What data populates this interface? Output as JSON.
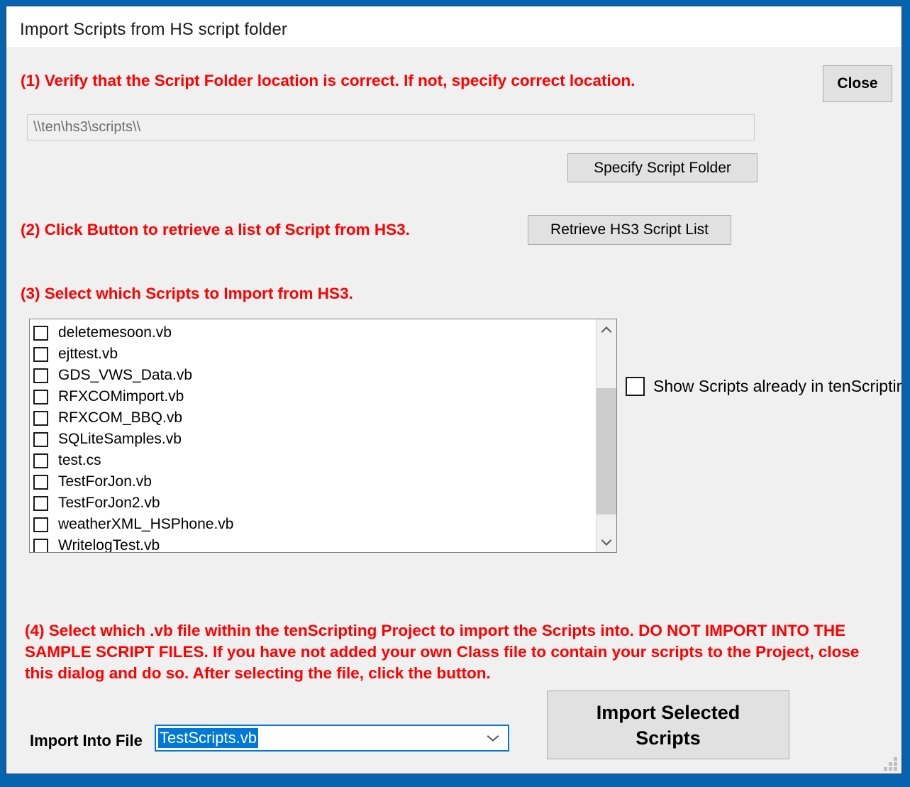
{
  "window": {
    "title": "Import Scripts from HS script folder",
    "border_color": "#0563af",
    "client_bg": "#f0f0f0",
    "instruction_color": "#ff0000",
    "accent_color": "#0078d7"
  },
  "steps": {
    "step1": "(1)  Verify that the Script Folder location is correct.   If not, specify correct location.",
    "step2": "(2)  Click Button to retrieve a list of Script from HS3.",
    "step3": "(3)  Select which Scripts to Import from HS3.",
    "step4": "(4)  Select which .vb file within the tenScripting Project to import the Scripts into.  DO NOT IMPORT INTO THE SAMPLE SCRIPT FILES.  If you have not added your own Class file to contain your scripts to the Project, close this dialog and do so.  After selecting the file, click the button."
  },
  "buttons": {
    "close": "Close",
    "specify_script_folder": "Specify Script Folder",
    "retrieve_script_list": "Retrieve HS3 Script List",
    "import_selected_line1": "Import Selected",
    "import_selected_line2": "Scripts"
  },
  "script_folder": {
    "value": "\\\\ten\\hs3\\scripts\\\\",
    "placeholder": "\\\\ten\\hs3\\scripts\\\\"
  },
  "script_list": {
    "items": [
      {
        "name": "deletemesoon.vb",
        "checked": false
      },
      {
        "name": "ejttest.vb",
        "checked": false
      },
      {
        "name": "GDS_VWS_Data.vb",
        "checked": false
      },
      {
        "name": "RFXCOMimport.vb",
        "checked": false
      },
      {
        "name": "RFXCOM_BBQ.vb",
        "checked": false
      },
      {
        "name": "SQLiteSamples.vb",
        "checked": false
      },
      {
        "name": "test.cs",
        "checked": false
      },
      {
        "name": "TestForJon.vb",
        "checked": false
      },
      {
        "name": "TestForJon2.vb",
        "checked": false
      },
      {
        "name": "weatherXML_HSPhone.vb",
        "checked": false
      },
      {
        "name": "WritelogTest.vb",
        "checked": false
      }
    ]
  },
  "show_existing": {
    "label": "Show Scripts already in tenScripting",
    "checked": false
  },
  "import_into": {
    "label": "Import  Into  File",
    "selected": "TestScripts.vb",
    "options": [
      "TestScripts.vb"
    ]
  }
}
